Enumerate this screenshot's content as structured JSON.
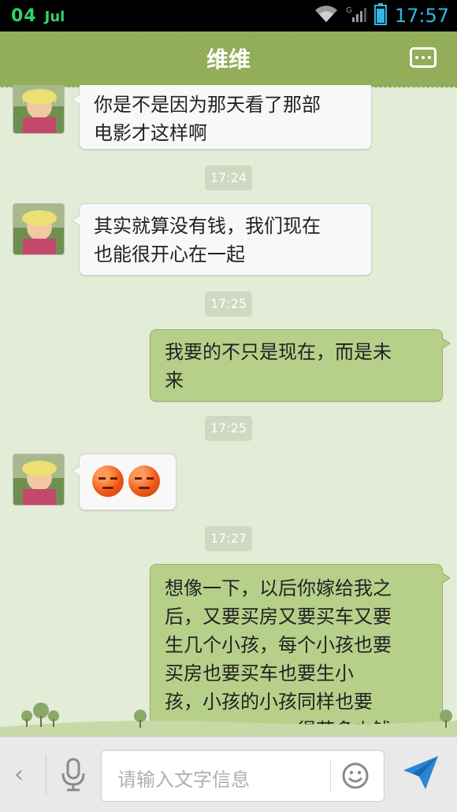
{
  "status_bar": {
    "date": "04",
    "month": "Jul",
    "time": "17:57"
  },
  "header": {
    "title": "维维"
  },
  "messages": [
    {
      "side": "in",
      "text_line1": "你是不是因为那天看了那部",
      "text_line2": "电影才这样啊"
    },
    {
      "timestamp": "17:24"
    },
    {
      "side": "in",
      "text_line1": "其实就算没有钱，我们现在",
      "text_line2": "也能很开心在一起"
    },
    {
      "timestamp": "17:25"
    },
    {
      "side": "out",
      "text_line1": "我要的不只是现在，而是未",
      "text_line2": "来"
    },
    {
      "timestamp": "17:25"
    },
    {
      "side": "in",
      "emoji": [
        "sleepy-face-icon",
        "sleepy-face-icon"
      ]
    },
    {
      "timestamp": "17:27"
    },
    {
      "side": "out",
      "lines": [
        "想像一下，以后你嫁给我之",
        "后，又要买房又要买车又要",
        "生几个小孩，每个小孩也要",
        "买房也要买车也要生小",
        "孩，小孩的小孩同样也要",
        "买………………得花多少钱呐！"
      ]
    }
  ],
  "input": {
    "placeholder": "请输入文字信息"
  },
  "colors": {
    "header": "#8fab54",
    "outgoing_bubble": "#b6d08a",
    "incoming_bubble": "#f8f8f8",
    "background": "#e3ecd6",
    "status_time": "#33b5e5",
    "status_date": "#2fd36b"
  },
  "icons": [
    "signal-icon",
    "battery-icon",
    "wifi-icon",
    "more-icon",
    "microphone-icon",
    "smiley-icon",
    "send-icon",
    "back-icon"
  ]
}
